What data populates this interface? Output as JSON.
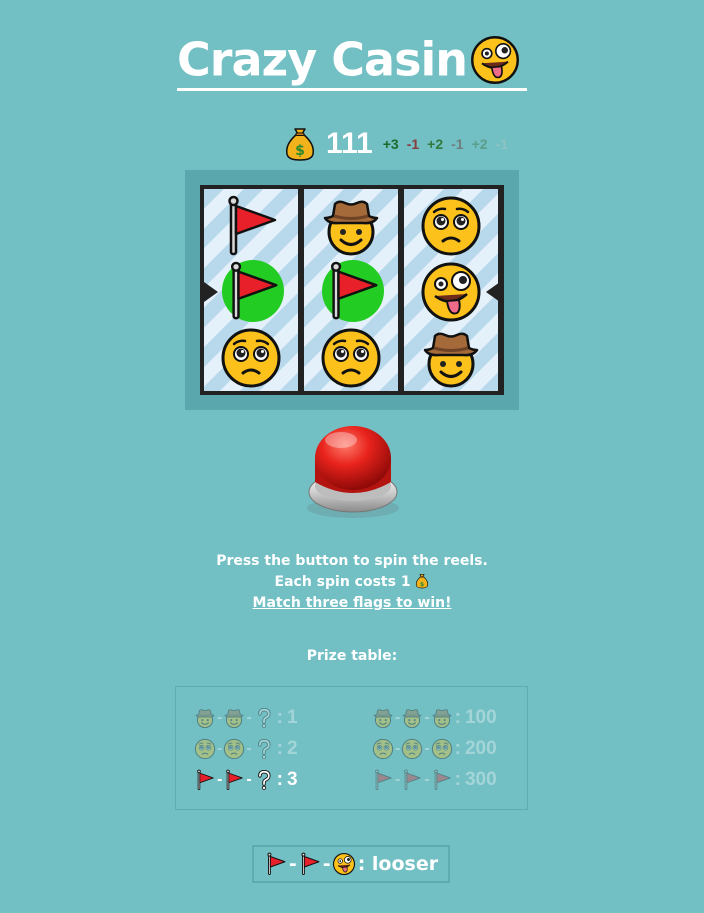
{
  "title": "Crazy Casin",
  "balance": {
    "icon": "money-bag-icon",
    "amount": "111",
    "deltas": [
      {
        "text": "+3",
        "color": "#1c6b2c"
      },
      {
        "text": "-1",
        "color": "#8a3b3b"
      },
      {
        "text": "+2",
        "color": "#2f7a3d"
      },
      {
        "text": "-1",
        "color": "#6f7f7f"
      },
      {
        "text": "+2",
        "color": "#5a9e8a"
      },
      {
        "text": "-1",
        "color": "#8fc3c2"
      }
    ]
  },
  "reels": [
    [
      "red-flag-icon",
      "red-flag-icon",
      "pleading-face-icon"
    ],
    [
      "cowboy-face-icon",
      "red-flag-icon",
      "pleading-face-icon"
    ],
    [
      "pleading-face-icon",
      "zany-face-icon",
      "cowboy-face-icon"
    ]
  ],
  "winning_row_highlight": [
    true,
    true,
    false
  ],
  "instructions": {
    "line1": "Press the button to spin the reels.",
    "line2": "Each spin costs 1",
    "line3": "Match three flags to win!"
  },
  "prize_table_title": "Prize table:",
  "prizes_left": [
    {
      "symbols": [
        "cowboy-face-icon",
        "cowboy-face-icon",
        "question-mark-icon"
      ],
      "value": "1",
      "dim": true
    },
    {
      "symbols": [
        "pleading-face-icon",
        "pleading-face-icon",
        "question-mark-icon"
      ],
      "value": "2",
      "dim": true
    },
    {
      "symbols": [
        "red-flag-icon",
        "red-flag-icon",
        "question-mark-icon"
      ],
      "value": "3",
      "dim": false
    }
  ],
  "prizes_right": [
    {
      "symbols": [
        "cowboy-face-icon",
        "cowboy-face-icon",
        "cowboy-face-icon"
      ],
      "value": "100",
      "dim": true
    },
    {
      "symbols": [
        "pleading-face-icon",
        "pleading-face-icon",
        "pleading-face-icon"
      ],
      "value": "200",
      "dim": true
    },
    {
      "symbols": [
        "red-flag-icon",
        "red-flag-icon",
        "red-flag-icon"
      ],
      "value": "300",
      "dim": true
    }
  ],
  "result": {
    "symbols": [
      "red-flag-icon",
      "red-flag-icon",
      "zany-face-icon"
    ],
    "label": "looser"
  },
  "colors": {
    "background": "#72bfc4",
    "machine": "#5aa8ad",
    "highlight": "#22cc22",
    "button": "#e01818"
  }
}
